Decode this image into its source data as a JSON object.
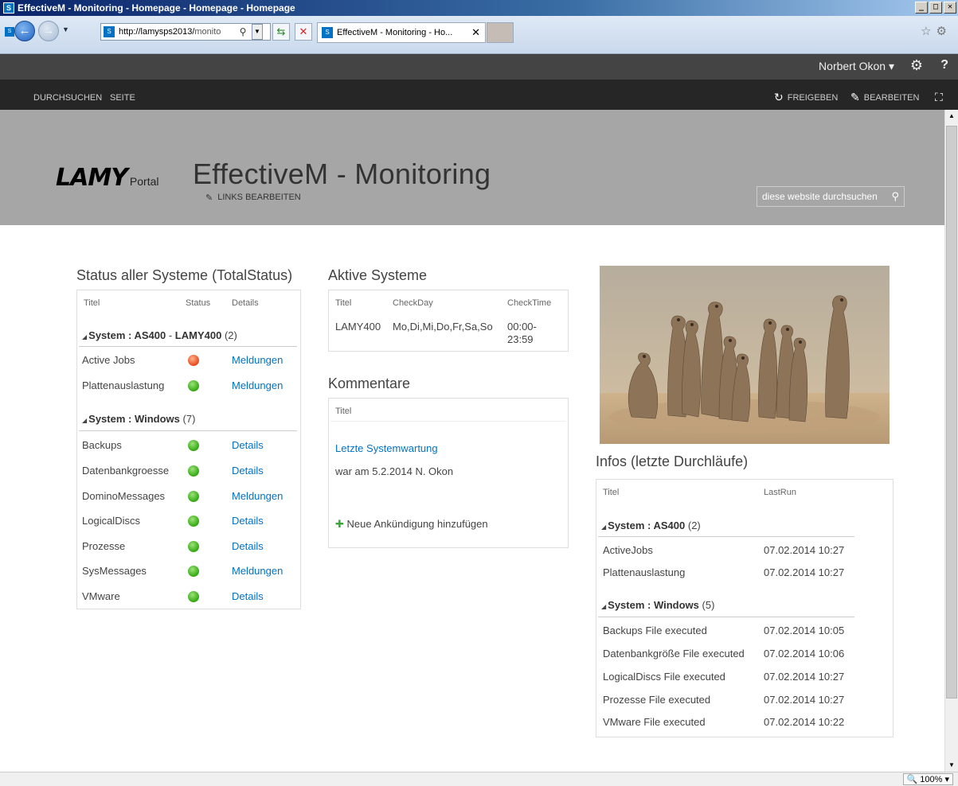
{
  "window": {
    "title": "EffectiveM - Monitoring - Homepage - Homepage - Homepage"
  },
  "browser": {
    "address_host": "http://lamysps2013/",
    "address_path": "monito",
    "tab_label": "EffectiveM - Monitoring - Ho...",
    "zoom": "100%"
  },
  "suitebar": {
    "user": "Norbert Okon ▾"
  },
  "ribbon": {
    "tabs": [
      "DURCHSUCHEN",
      "SEITE"
    ],
    "share": "FREIGEBEN",
    "edit": "BEARBEITEN"
  },
  "header": {
    "logo_main": "LAMY",
    "logo_sub": "Portal",
    "site_title": "EffectiveM - Monitoring",
    "edit_links": "LINKS BEARBEITEN",
    "search_placeholder": "diese website durchsuchen"
  },
  "status_part": {
    "title": "Status aller Systeme (TotalStatus)",
    "columns": [
      "Titel",
      "Status",
      "Details"
    ],
    "groups": [
      {
        "prefix": "System : ",
        "name_a": "AS400",
        "sep": " - ",
        "name_b": "LAMY400",
        "count": "(2)",
        "rows": [
          {
            "title": "Active Jobs",
            "status": "red",
            "details": "Meldungen"
          },
          {
            "title": "Plattenauslastung",
            "status": "green",
            "details": "Meldungen"
          }
        ]
      },
      {
        "prefix": "System : ",
        "name_a": "Windows",
        "count": "(7)",
        "rows": [
          {
            "title": "Backups",
            "status": "green",
            "details": "Details"
          },
          {
            "title": "Datenbankgroesse",
            "status": "green",
            "details": "Details"
          },
          {
            "title": "DominoMessages",
            "status": "green",
            "details": "Meldungen"
          },
          {
            "title": "LogicalDiscs",
            "status": "green",
            "details": "Details"
          },
          {
            "title": "Prozesse",
            "status": "green",
            "details": "Details"
          },
          {
            "title": "SysMessages",
            "status": "green",
            "details": "Meldungen"
          },
          {
            "title": "VMware",
            "status": "green",
            "details": "Details"
          }
        ]
      }
    ]
  },
  "active_part": {
    "title": "Aktive Systeme",
    "columns": [
      "Titel",
      "CheckDay",
      "CheckTime"
    ],
    "rows": [
      {
        "title": "LAMY400",
        "checkday": "Mo,Di,Mi,Do,Fr,Sa,So",
        "checktime_1": "00:00-",
        "checktime_2": "23:59"
      }
    ]
  },
  "comments_part": {
    "title": "Kommentare",
    "column": "Titel",
    "item_title": "Letzte Systemwartung",
    "item_body": "war am 5.2.2014 N. Okon",
    "add_label": "Neue Ankündigung hinzufügen"
  },
  "infos_part": {
    "title": "Infos (letzte Durchläufe)",
    "columns": [
      "Titel",
      "LastRun"
    ],
    "groups": [
      {
        "prefix": "System : ",
        "name": "AS400",
        "count": "(2)",
        "rows": [
          {
            "title": "ActiveJobs",
            "lastrun": "07.02.2014 10:27"
          },
          {
            "title": "Plattenauslastung",
            "lastrun": "07.02.2014 10:27"
          }
        ]
      },
      {
        "prefix": "System : ",
        "name": "Windows",
        "count": "(5)",
        "rows": [
          {
            "title": "Backups File executed",
            "lastrun": "07.02.2014 10:05"
          },
          {
            "title": "Datenbankgröße File executed",
            "lastrun": "07.02.2014 10:06"
          },
          {
            "title": "LogicalDiscs File executed",
            "lastrun": "07.02.2014 10:27"
          },
          {
            "title": "Prozesse File executed",
            "lastrun": "07.02.2014 10:27"
          },
          {
            "title": "VMware File executed",
            "lastrun": "07.02.2014 10:22"
          }
        ]
      }
    ]
  },
  "colors": {
    "link": "#0072c6",
    "status_green": "#32a80f",
    "status_red": "#e8491d",
    "header_bg": "#a6a6a6"
  }
}
